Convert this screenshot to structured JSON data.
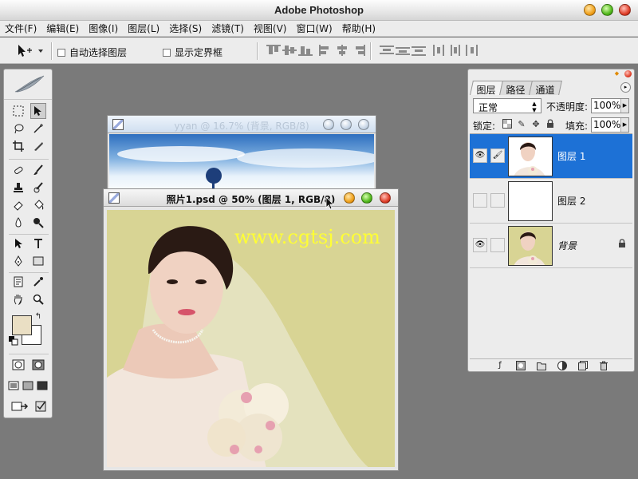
{
  "app": {
    "title": "Adobe Photoshop"
  },
  "menu": [
    "文件(F)",
    "编辑(E)",
    "图像(I)",
    "图层(L)",
    "选择(S)",
    "滤镜(T)",
    "视图(V)",
    "窗口(W)",
    "帮助(H)"
  ],
  "options": {
    "auto_select_label": "自动选择图层",
    "show_bounds_label": "显示定界框"
  },
  "windows": {
    "back_doc_title": "yyan @ 16.7% (背景, RGB/8)",
    "front_doc_title": "照片1.psd @ 50% (图层 1, RGB/8)",
    "watermark": "www.cgtsj.com"
  },
  "layers_panel": {
    "tabs": [
      "图层",
      "路径",
      "通道"
    ],
    "blend_mode": "正常",
    "opacity_label": "不透明度:",
    "opacity_value": "100%",
    "lock_label": "锁定:",
    "fill_label": "填充:",
    "fill_value": "100%",
    "layers": [
      {
        "name": "图层 1",
        "selected": true,
        "visible": true
      },
      {
        "name": "图层 2",
        "selected": false,
        "visible": false
      },
      {
        "name": "背景",
        "selected": false,
        "visible": true,
        "locked": true
      }
    ]
  },
  "colors": {
    "foreground": "#eadfc4",
    "background": "#ffffff",
    "selection": "#1d71d6",
    "workspace": "#7a7a7a",
    "watermark": "#ffff33"
  }
}
